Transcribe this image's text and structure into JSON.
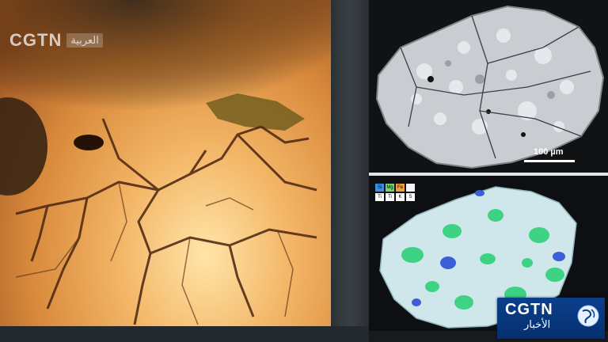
{
  "watermark": {
    "brand": "CGTN",
    "arabic": "العربية"
  },
  "sem_image": {
    "scale_label": "100 µm"
  },
  "element_map": {
    "legend": [
      "Si",
      "Mg",
      "Fe",
      "",
      "Ti",
      "Ti",
      "K",
      "S"
    ],
    "legend_colors": [
      "#3a8ee6",
      "#6cd96b",
      "#f0a040",
      "#f4f4f4",
      "#ffffff",
      "#ffffff",
      "#ffffff",
      "#ffffff"
    ]
  },
  "logo": {
    "brand": "CGTN",
    "arabic": "الأخبار"
  },
  "colors": {
    "optical_glow": "#f3b566",
    "map_green": "#2fd07a",
    "map_blue": "#3c5fd8",
    "logo_blue": "#0a3f8c"
  }
}
